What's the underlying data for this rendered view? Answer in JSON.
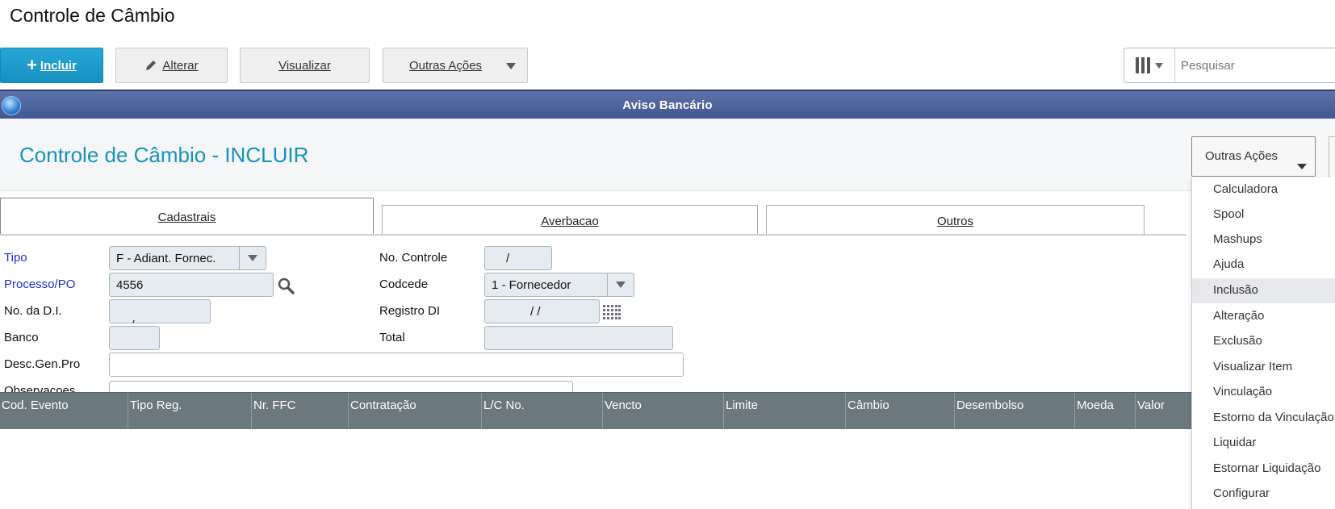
{
  "page": {
    "title": "Controle de Câmbio"
  },
  "toolbar": {
    "incluir_label": "Incluir",
    "alterar_label": "Alterar",
    "visualizar_label": "Visualizar",
    "outras_acoes_label": "Outras Ações",
    "search_placeholder": "Pesquisar"
  },
  "dialog": {
    "title": "Aviso Bancário"
  },
  "form": {
    "title": "Controle de Câmbio - INCLUIR",
    "actions_label": "Outras Ações",
    "tabs": [
      {
        "label": "Cadastrais",
        "active": true
      },
      {
        "label": "Averbacao",
        "active": false
      },
      {
        "label": "Outros",
        "active": false
      }
    ],
    "fields": {
      "tipo": {
        "label": "Tipo",
        "value": "F - Adiant. Fornec."
      },
      "processo": {
        "label": "Processo/PO",
        "value": "4556"
      },
      "no_di": {
        "label": "No. da D.I.",
        "value": "/      -"
      },
      "banco": {
        "label": "Banco",
        "value": ""
      },
      "desc": {
        "label": "Desc.Gen.Pro",
        "value": ""
      },
      "observacoes": {
        "label": "Observacoes"
      },
      "no_controle": {
        "label": "No. Controle",
        "value": "/"
      },
      "codcede": {
        "label": "Codcede",
        "value": "1 - Fornecedor"
      },
      "registro_di": {
        "label": "Registro DI",
        "value": "/  /"
      },
      "total": {
        "label": "Total",
        "value": ""
      }
    }
  },
  "table": {
    "columns": [
      "Cod. Evento",
      "Tipo Reg.",
      "Nr. FFC",
      "Contratação",
      "L/C No.",
      "Vencto",
      "Limite",
      "Câmbio",
      "Desembolso",
      "Moeda",
      "Valor"
    ]
  },
  "menu": {
    "items": [
      {
        "label": "Calculadora",
        "highlighted": false
      },
      {
        "label": "Spool",
        "highlighted": false
      },
      {
        "label": "Mashups",
        "highlighted": false
      },
      {
        "label": "Ajuda",
        "highlighted": false
      },
      {
        "label": "Inclusão",
        "highlighted": true
      },
      {
        "label": "Alteração",
        "highlighted": false
      },
      {
        "label": "Exclusão",
        "highlighted": false
      },
      {
        "label": "Visualizar Item",
        "highlighted": false
      },
      {
        "label": "Vinculação",
        "highlighted": false
      },
      {
        "label": "Estorno da Vinculação",
        "highlighted": false
      },
      {
        "label": "Liquidar",
        "highlighted": false
      },
      {
        "label": "Estornar Liquidação",
        "highlighted": false
      },
      {
        "label": "Configurar",
        "highlighted": false
      }
    ]
  },
  "colors": {
    "accent": "#1690bf",
    "form_title": "#1793b9",
    "dialog_bar": "#4a5f99",
    "table_header": "#6b787e",
    "required_label": "#1a2fd0"
  }
}
